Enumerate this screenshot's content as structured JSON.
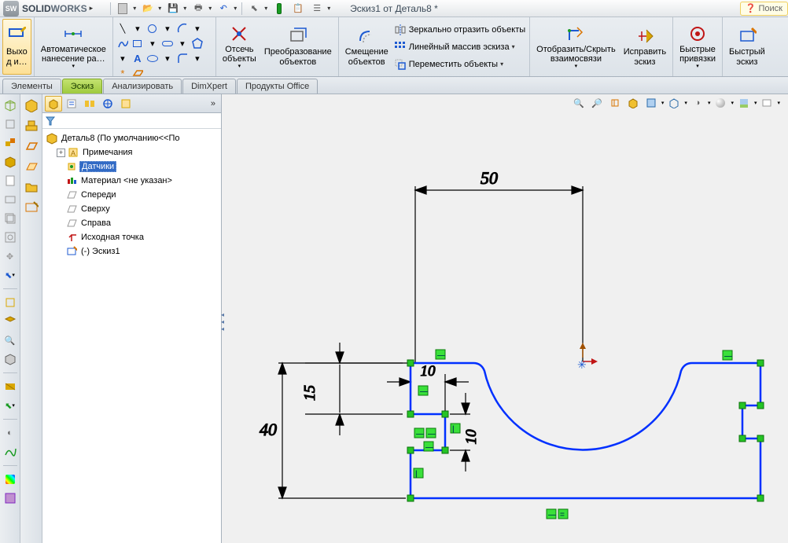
{
  "app": {
    "name_solid": "SOLID",
    "name_works": "WORKS"
  },
  "doc_title": "Эскиз1 от Деталь8 *",
  "search_placeholder": "Поиск",
  "ribbon": {
    "exit_sketch": "Выхо\nд и…",
    "smart_dim": "Автоматическое\nнанесение ра…",
    "cut": "Отсечь\nобъекты",
    "convert": "Преобразование\nобъектов",
    "offset": "Смещение\nобъектов",
    "mirror": "Зеркально отразить объекты",
    "linear_pattern": "Линейный массив эскиза",
    "move": "Переместить объекты",
    "show_hide": "Отобразить/Скрыть\nвзаимосвязи",
    "repair": "Исправить\nэскиз",
    "quick_snaps": "Быстрые\nпривязки",
    "rapid_sketch": "Быстрый\nэскиз"
  },
  "tabs": {
    "features": "Элементы",
    "sketch": "Эскиз",
    "evaluate": "Анализировать",
    "dimxpert": "DimXpert",
    "office": "Продукты Office"
  },
  "tree": {
    "root": "Деталь8  (По умолчанию<<По",
    "items": [
      "Примечания",
      "Датчики",
      "Материал <не указан>",
      "Спереди",
      "Сверху",
      "Справа",
      "Исходная точка",
      "(-) Эскиз1"
    ]
  },
  "dims": {
    "d50": "50",
    "d40": "40",
    "d15": "15",
    "d10a": "10",
    "d10b": "10"
  }
}
